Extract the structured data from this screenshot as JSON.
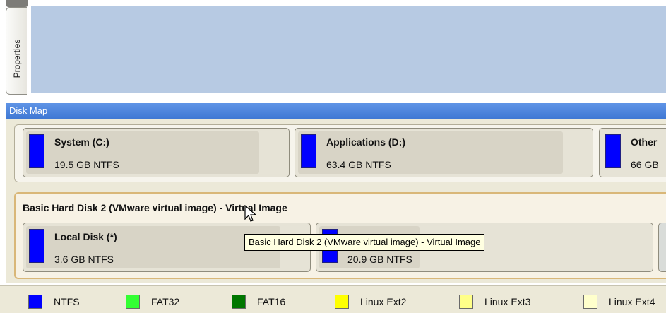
{
  "sidebar": {
    "properties_tab": "Properties"
  },
  "disk_map": {
    "title": "Disk Map",
    "disk1": {
      "partitions": [
        {
          "name": "System (C:)",
          "size": "19.5 GB NTFS",
          "color": "#0000ff"
        },
        {
          "name": "Applications (D:)",
          "size": "63.4 GB NTFS",
          "color": "#0000ff"
        },
        {
          "name": "Other",
          "size": "66 GB",
          "color": "#0000ff"
        }
      ]
    },
    "disk2": {
      "title": "Basic Hard Disk 2 (VMware virtual image) - Virtual Image",
      "partitions": [
        {
          "name": "Local Disk (*)",
          "size": "3.6 GB NTFS",
          "color": "#0000ff"
        },
        {
          "name": "",
          "size": "20.9 GB NTFS",
          "color": "#0000ff"
        }
      ]
    },
    "tooltip": "Basic Hard Disk 2 (VMware virtual image) - Virtual Image"
  },
  "legend": [
    {
      "label": "NTFS",
      "color": "#0000ff"
    },
    {
      "label": "FAT32",
      "color": "#33ff33"
    },
    {
      "label": "FAT16",
      "color": "#007700"
    },
    {
      "label": "Linux Ext2",
      "color": "#ffff00"
    },
    {
      "label": "Linux Ext3",
      "color": "#ffff88"
    },
    {
      "label": "Linux Ext4",
      "color": "#ffffcc"
    }
  ]
}
